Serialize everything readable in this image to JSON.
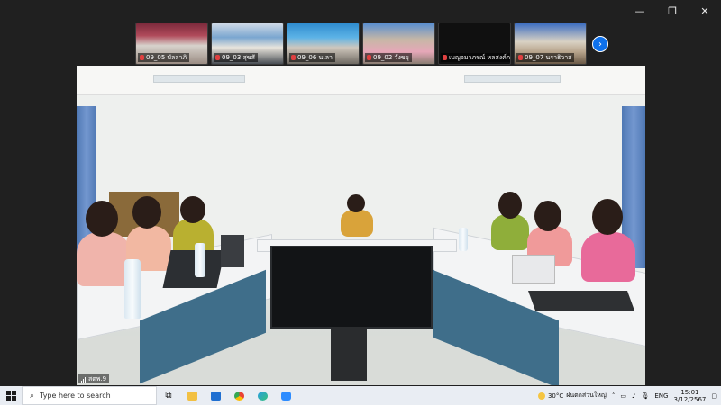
{
  "window_controls": {
    "minimize": "—",
    "restore": "❐",
    "close": "✕"
  },
  "participants": [
    {
      "label": "09_05 บัลลาภิ"
    },
    {
      "label": "09_03 สุขสั"
    },
    {
      "label": "09_06 นเลา"
    },
    {
      "label": "09_02 วังขยุ"
    },
    {
      "label": "เบญจมาภรณ์ หลสงค์กลุ"
    },
    {
      "label": "09_07 นราธิวาส"
    }
  ],
  "next_page_icon": "chevron-right-icon",
  "main_video": {
    "name_tag": "สตพ.9"
  },
  "taskbar": {
    "search_placeholder": "Type here to search",
    "apps": [
      "task-view-icon",
      "file-explorer-icon",
      "mail-icon",
      "chrome-icon",
      "edge-icon",
      "zoom-icon"
    ],
    "weather_temp": "30°C",
    "weather_text": "ฝนตกส่วนใหญ่",
    "language": "ENG",
    "time": "15:01",
    "date": "3/12/2567"
  },
  "colors": {
    "accent": "#0e71eb",
    "mute": "#e04040"
  }
}
